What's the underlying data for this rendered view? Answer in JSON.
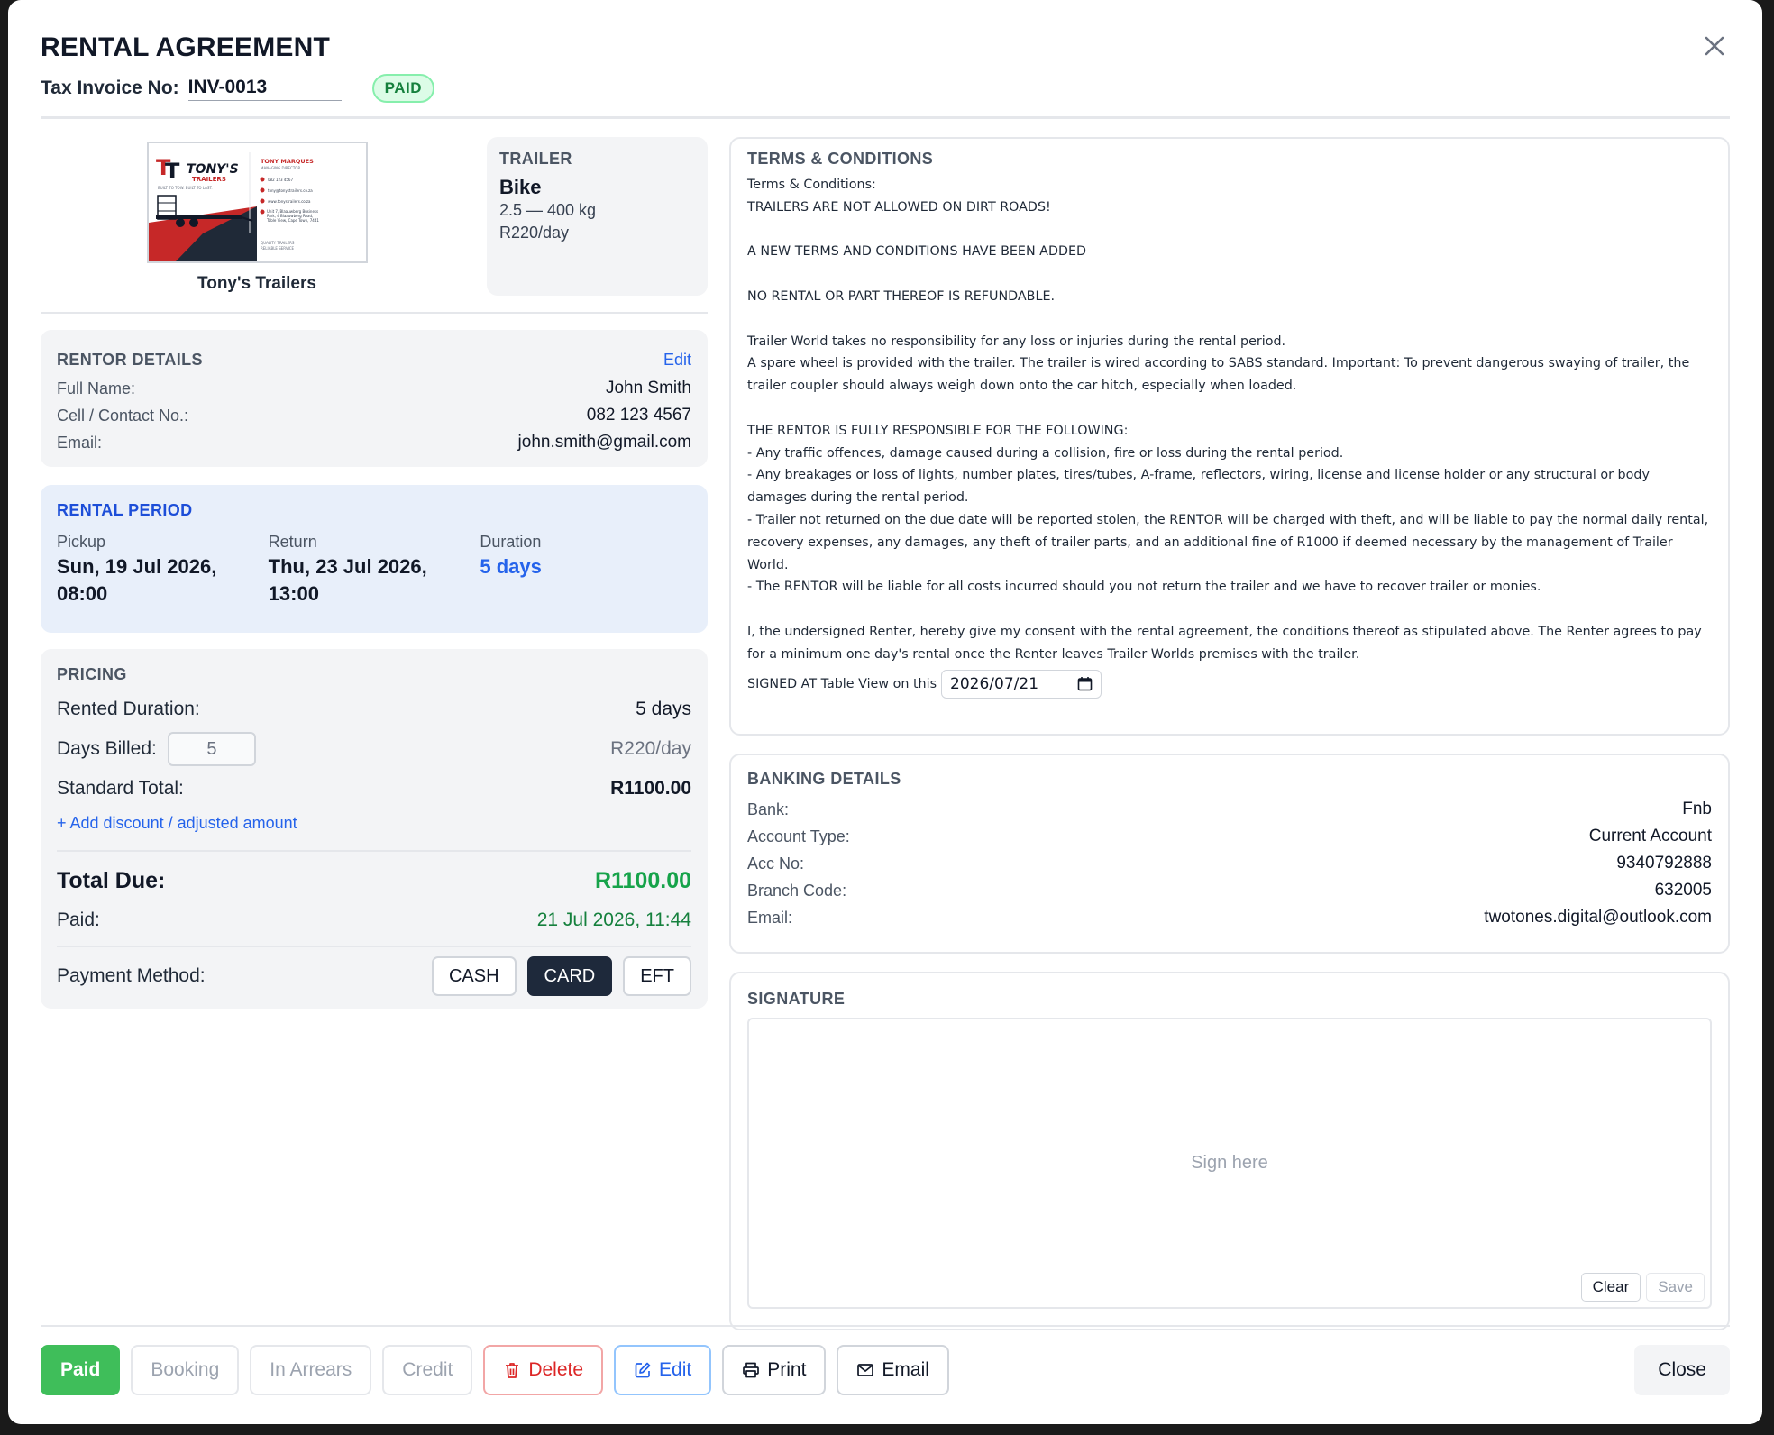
{
  "header": {
    "title": "RENTAL AGREEMENT",
    "invoice_label": "Tax Invoice No:",
    "invoice_value": "INV-0013",
    "status_badge": "PAID",
    "close_icon": "close-icon"
  },
  "business": {
    "name": "Tony's Trailers",
    "card": {
      "logo_text": "TONY'S",
      "logo_sub": "TRAILERS",
      "tagline": "BUILT TO TOW. BUILT TO LAST.",
      "contact_name": "TONY MARQUES",
      "contact_title": "MANAGING DIRECTOR",
      "lines": [
        "082 123 4567",
        "tony@tonystrailers.co.za",
        "www.tonystrailers.co.za",
        "Unit 7, Blaauwberg Business Park, 4 Blaauwberg Road, Table View, Cape Town, 7441"
      ],
      "footer_1": "QUALITY TRAILERS",
      "footer_2": "RELIABLE SERVICE"
    }
  },
  "trailer": {
    "section_title": "TRAILER",
    "name": "Bike",
    "capacity": "2.5 — 400 kg",
    "rate": "R220/day"
  },
  "renter": {
    "section_title": "RENTOR DETAILS",
    "edit_label": "Edit",
    "fields": [
      {
        "label": "Full Name:",
        "value": "John Smith"
      },
      {
        "label": "Cell / Contact No.:",
        "value": "082 123 4567"
      },
      {
        "label": "Email:",
        "value": "john.smith@gmail.com"
      }
    ]
  },
  "period": {
    "section_title": "RENTAL PERIOD",
    "pickup_label": "Pickup",
    "pickup_value": "Sun, 19 Jul 2026, 08:00",
    "return_label": "Return",
    "return_value": "Thu, 23 Jul 2026, 13:00",
    "duration_label": "Duration",
    "duration_value": "5 days"
  },
  "pricing": {
    "section_title": "PRICING",
    "rented_duration_label": "Rented Duration:",
    "rented_duration_value": "5 days",
    "days_billed_label": "Days Billed:",
    "days_billed_value": "5",
    "rate": "R220/day",
    "standard_total_label": "Standard Total:",
    "standard_total_value": "R1100.00",
    "add_discount": "+ Add discount / adjusted amount",
    "total_due_label": "Total Due:",
    "total_due_value": "R1100.00",
    "paid_label": "Paid:",
    "paid_value": "21 Jul 2026, 11:44",
    "payment_method_label": "Payment Method:",
    "payment_methods": [
      "CASH",
      "CARD",
      "EFT"
    ],
    "selected_method": "CARD"
  },
  "terms": {
    "section_title": "TERMS & CONDITIONS",
    "body": "Terms & Conditions:\nTRAILERS ARE NOT ALLOWED ON DIRT ROADS!\n\nA NEW TERMS AND CONDITIONS HAVE BEEN ADDED\n\nNO RENTAL OR PART THEREOF IS REFUNDABLE.\n\nTrailer World takes no responsibility for any loss or injuries during the rental period.\nA spare wheel is provided with the trailer. The trailer is wired according to SABS standard. Important: To prevent dangerous swaying of trailer, the trailer coupler should always weigh down onto the car hitch, especially when loaded.\n\nTHE RENTOR IS FULLY RESPONSIBLE FOR THE FOLLOWING:\n- Any traffic offences, damage caused during a collision, fire or loss during the rental period.\n- Any breakages or loss of lights, number plates, tires/tubes, A-frame, reflectors, wiring, license and license holder or any structural or body damages during the rental period.\n- Trailer not returned on the due date will be reported stolen, the RENTOR will be charged with theft, and will be liable to pay the normal daily rental, recovery expenses, any damages, any theft of trailer parts, and an additional fine of R1000 if deemed necessary by the management of Trailer World.\n- The RENTOR will be liable for all costs incurred should you not return the trailer and we have to recover trailer or monies.\n\nI, the undersigned Renter, hereby give my consent with the rental agreement, the conditions thereof as stipulated above. The Renter agrees to pay for a minimum one day's rental once the Renter leaves Trailer Worlds premises with the trailer.",
    "signed_at_label": "SIGNED AT Table View on this",
    "signed_date": "2026/07/21"
  },
  "banking": {
    "section_title": "BANKING DETAILS",
    "fields": [
      {
        "label": "Bank:",
        "value": "Fnb"
      },
      {
        "label": "Account Type:",
        "value": "Current Account"
      },
      {
        "label": "Acc No:",
        "value": "9340792888"
      },
      {
        "label": "Branch Code:",
        "value": "632005"
      },
      {
        "label": "Email:",
        "value": "twotones.digital@outlook.com"
      }
    ]
  },
  "signature": {
    "section_title": "SIGNATURE",
    "placeholder": "Sign here",
    "clear_label": "Clear",
    "save_label": "Save"
  },
  "footer": {
    "paid": "Paid",
    "booking": "Booking",
    "in_arrears": "In Arrears",
    "credit": "Credit",
    "delete": "Delete",
    "edit": "Edit",
    "print": "Print",
    "email": "Email",
    "close": "Close"
  },
  "colors": {
    "accent_blue": "#2563eb",
    "paid_green": "#3fbe5a",
    "total_green": "#16a34a",
    "danger_red": "#dc2626",
    "dark_button": "#1e293b"
  }
}
